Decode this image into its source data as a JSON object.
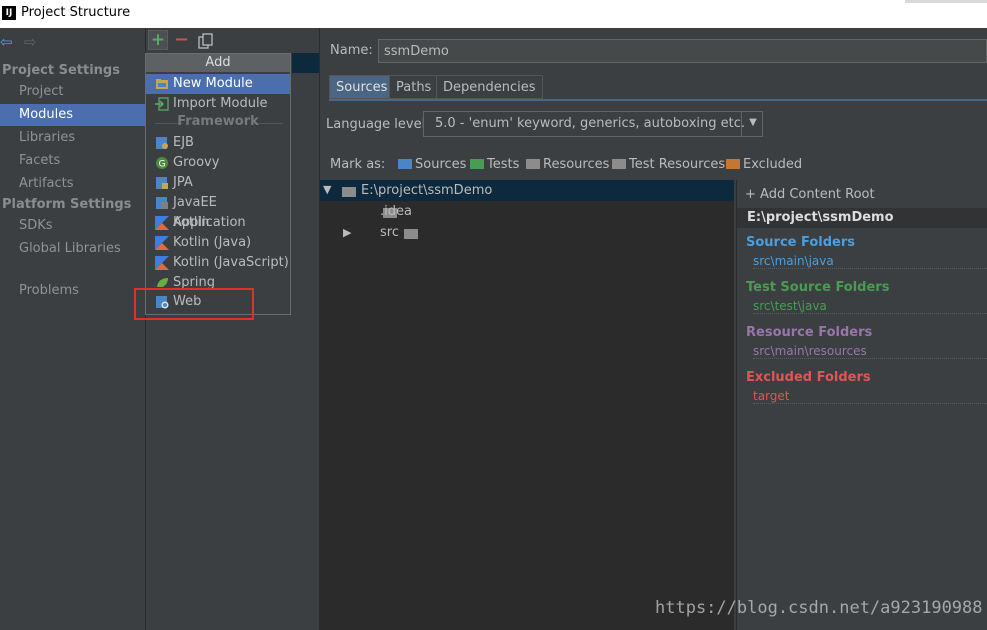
{
  "window": {
    "title": "Project Structure",
    "app_icon": "IJ"
  },
  "left_nav": {
    "sections": [
      {
        "header": "Project Settings",
        "items": [
          "Project",
          "Modules",
          "Libraries",
          "Facets",
          "Artifacts"
        ]
      },
      {
        "header": "Platform Settings",
        "items": [
          "SDKs",
          "Global Libraries"
        ]
      }
    ],
    "problems": "Problems",
    "selected": "Modules"
  },
  "toolbar": {
    "add": "+",
    "remove": "−"
  },
  "add_popup": {
    "header": "Add",
    "items_top": [
      {
        "label": "New Module",
        "icon": "module-folder-icon",
        "highlighted": true
      },
      {
        "label": "Import Module",
        "icon": "import-icon",
        "highlighted": false
      }
    ],
    "framework_header": "Framework",
    "frameworks": [
      {
        "label": "EJB",
        "icon": "ejb-icon"
      },
      {
        "label": "Groovy",
        "icon": "groovy-icon"
      },
      {
        "label": "JPA",
        "icon": "jpa-icon"
      },
      {
        "label": "JavaEE Application",
        "icon": "javaee-icon"
      },
      {
        "label": "Kotlin",
        "icon": "kotlin-icon"
      },
      {
        "label": "Kotlin (Java)",
        "icon": "kotlin-icon"
      },
      {
        "label": "Kotlin (JavaScript)",
        "icon": "kotlin-icon"
      },
      {
        "label": "Spring",
        "icon": "spring-icon"
      },
      {
        "label": "Web",
        "icon": "web-icon"
      }
    ]
  },
  "module": {
    "name_label": "Name:",
    "name_value": "ssmDemo",
    "tabs": [
      "Sources",
      "Paths",
      "Dependencies"
    ],
    "active_tab": "Sources",
    "language_level_label": "Language level:",
    "language_level_value": "5.0 - 'enum' keyword, generics, autoboxing etc.",
    "mark_as_label": "Mark as:",
    "mark_as": [
      {
        "label": "Sources",
        "color": "#4a86c7"
      },
      {
        "label": "Tests",
        "color": "#499c54"
      },
      {
        "label": "Resources",
        "color": "#8c8c8c"
      },
      {
        "label": "Test Resources",
        "color": "#8c8c8c"
      },
      {
        "label": "Excluded",
        "color": "#c57633"
      }
    ]
  },
  "tree": {
    "root": "E:\\project\\ssmDemo",
    "children": [
      ".idea",
      "src"
    ]
  },
  "content_roots": {
    "add_label": "+ Add Content Root",
    "root_path": "E:\\project\\ssmDemo",
    "groups": [
      {
        "title": "Source Folders",
        "path": "src\\main\\java",
        "color": "#4a9fe0"
      },
      {
        "title": "Test Source Folders",
        "path": "src\\test\\java",
        "color": "#499c54"
      },
      {
        "title": "Resource Folders",
        "path": "src\\main\\resources",
        "color": "#9876aa"
      },
      {
        "title": "Excluded Folders",
        "path": "target",
        "color": "#e05555"
      }
    ]
  },
  "watermark": "https://blog.csdn.net/a923190988"
}
